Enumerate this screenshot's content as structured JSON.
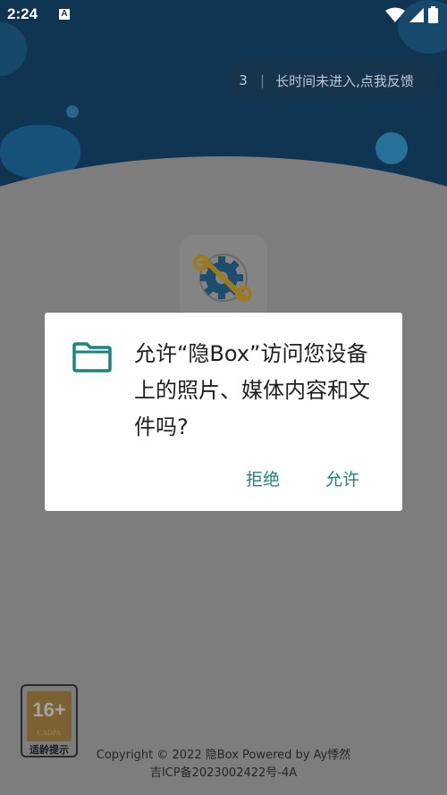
{
  "status_bar": {
    "time": "2:24",
    "notification_letter": "A",
    "icons": [
      "wifi-icon",
      "signal-icon",
      "battery-icon"
    ]
  },
  "feedback": {
    "count": "3",
    "separator": "|",
    "text": "长时间未进入,点我反馈"
  },
  "dialog": {
    "icon": "folder-icon",
    "message": "允许“隐Box”访问您设备上的照片、媒体内容和文件吗?",
    "deny_label": "拒绝",
    "allow_label": "允许",
    "accent_color": "#1a847e"
  },
  "age_badge": {
    "rating": "16+",
    "org": "CADPA",
    "label": "适龄提示"
  },
  "footer": {
    "copyright": "Copyright © 2022 隐Box Powered by Ay悸然",
    "icp": "吉ICP备2023002422号-4A"
  },
  "colors": {
    "header_blue": "#0f3552",
    "scrim_gray": "#7d7d7d"
  }
}
